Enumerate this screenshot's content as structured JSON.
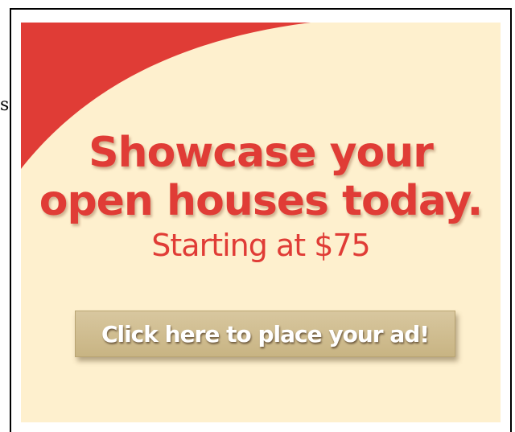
{
  "page": {
    "stray_char": "s"
  },
  "ad": {
    "headline_line1": "Showcase your",
    "headline_line2": "open houses today.",
    "subline": "Starting at $75",
    "cta_label": "Click here to place your ad!",
    "colors": {
      "background": "#fef0ce",
      "accent_red": "#e03c36",
      "button": "#d2c192",
      "button_text": "#ffffff"
    }
  }
}
